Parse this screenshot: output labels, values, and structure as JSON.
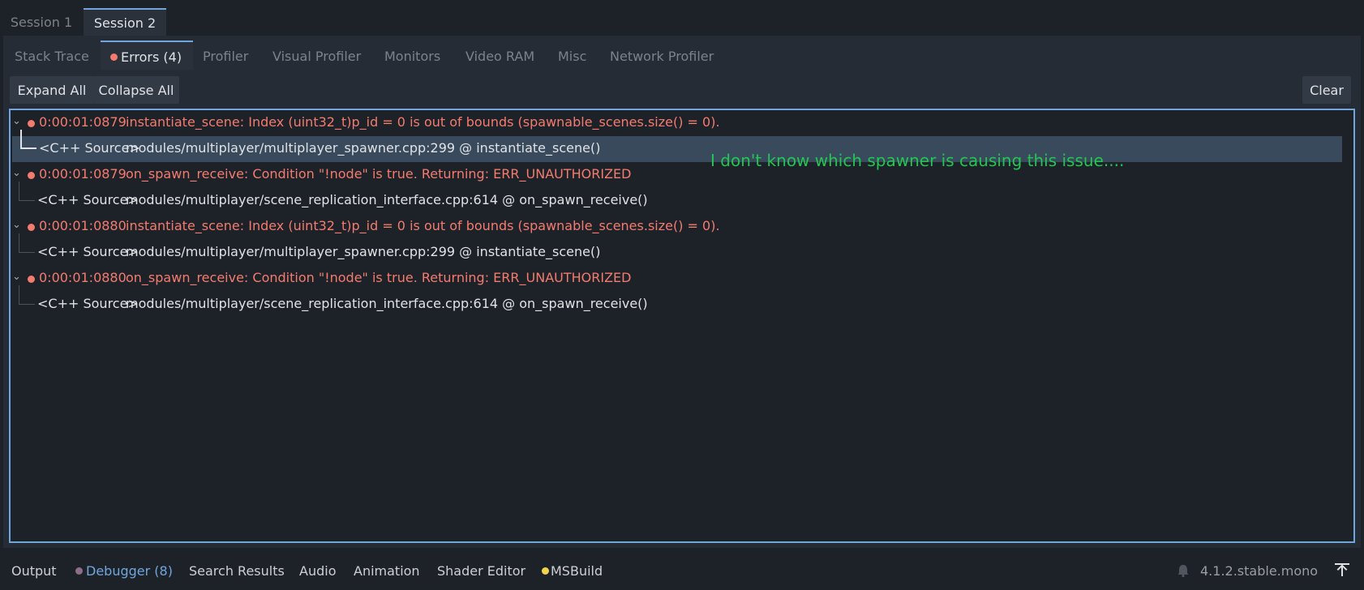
{
  "sessions": [
    "Session 1",
    "Session 2"
  ],
  "subtabs": [
    {
      "label": "Stack Trace"
    },
    {
      "label": "Errors (4)"
    },
    {
      "label": "Profiler"
    },
    {
      "label": "Visual Profiler"
    },
    {
      "label": "Monitors"
    },
    {
      "label": "Video RAM"
    },
    {
      "label": "Misc"
    },
    {
      "label": "Network Profiler"
    }
  ],
  "toolbar": {
    "expand_all": "Expand All",
    "collapse_all": "Collapse All",
    "clear": "Clear"
  },
  "errors": [
    {
      "time": "0:00:01:0879",
      "message": "instantiate_scene: Index (uint32_t)p_id = 0 is out of bounds (spawnable_scenes.size() = 0).",
      "source_label": "<C++ Source>",
      "source": "modules/multiplayer/multiplayer_spawner.cpp:299 @ instantiate_scene()"
    },
    {
      "time": "0:00:01:0879",
      "message": "on_spawn_receive: Condition \"!node\" is true. Returning: ERR_UNAUTHORIZED",
      "source_label": "<C++ Source>",
      "source": "modules/multiplayer/scene_replication_interface.cpp:614 @ on_spawn_receive()"
    },
    {
      "time": "0:00:01:0880",
      "message": "instantiate_scene: Index (uint32_t)p_id = 0 is out of bounds (spawnable_scenes.size() = 0).",
      "source_label": "<C++ Source>",
      "source": "modules/multiplayer/multiplayer_spawner.cpp:299 @ instantiate_scene()"
    },
    {
      "time": "0:00:01:0880",
      "message": "on_spawn_receive: Condition \"!node\" is true. Returning: ERR_UNAUTHORIZED",
      "source_label": "<C++ Source>",
      "source": "modules/multiplayer/scene_replication_interface.cpp:614 @ on_spawn_receive()"
    }
  ],
  "annotation": "I don't know which spawner is causing this issue....",
  "bottom_tabs": [
    {
      "label": "Output"
    },
    {
      "label": "Debugger (8)"
    },
    {
      "label": "Search Results"
    },
    {
      "label": "Audio"
    },
    {
      "label": "Animation"
    },
    {
      "label": "Shader Editor"
    },
    {
      "label": "MSBuild"
    }
  ],
  "version": "4.1.2.stable.mono",
  "colors": {
    "accent": "#70a6dd",
    "error": "#f47b6d",
    "annotation": "#23c553",
    "msbuild_dot": "#f0d34d",
    "debugger_dot": "#8c6e8c"
  }
}
